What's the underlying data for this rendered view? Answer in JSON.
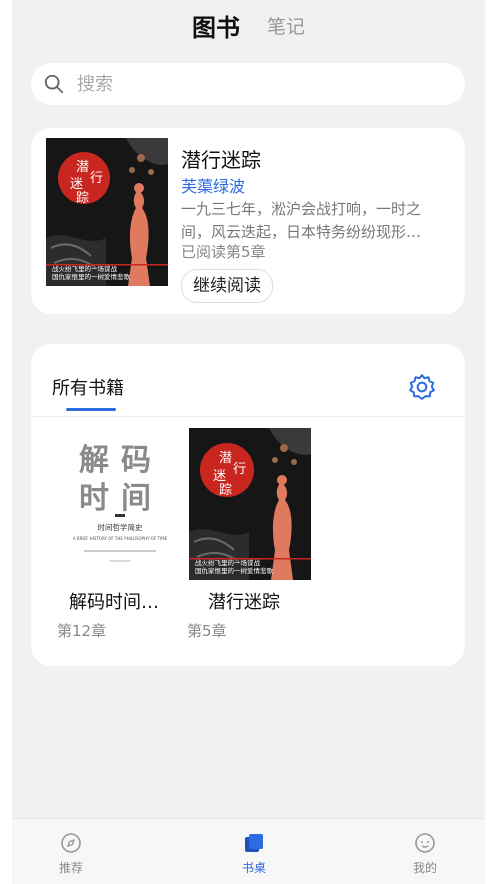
{
  "header": {
    "tab_books": "图书",
    "tab_notes": "笔记"
  },
  "search": {
    "placeholder": "搜索"
  },
  "recent": {
    "title": "潜行迷踪",
    "author": "芙蕖绿波",
    "desc_line1": "一九三七年，淞沪会战打响，一时之",
    "desc_line2": "间，风云迭起，日本特务纷纷现形…",
    "progress": "已阅读第5章",
    "continue_label": "继续阅读",
    "cover_title": "潜行迷踪",
    "cover_tagline_1": "战火纷飞里的一场谍战",
    "cover_tagline_2": "国仇家恨里的一树爱情悲歌"
  },
  "shelf": {
    "title": "所有书籍",
    "books": [
      {
        "name": "解码时间…",
        "chapter": "第12章",
        "cover_title": "解码时间",
        "cover_subtitle": "时间哲学简史",
        "cover_en": "A BRIEF HISTORY OF THE PHILOSOPHY OF TIME"
      },
      {
        "name": "潜行迷踪",
        "chapter": "第5章",
        "cover_title": "潜行迷踪"
      }
    ]
  },
  "bottom_nav": {
    "recommend": "推荐",
    "desk": "书桌",
    "me": "我的"
  },
  "colors": {
    "accent": "#2d6be0",
    "background": "#f1f1f3",
    "card": "#ffffff"
  },
  "icons": [
    "search-icon",
    "gear-icon",
    "compass-icon",
    "desk-icon",
    "smile-icon"
  ]
}
